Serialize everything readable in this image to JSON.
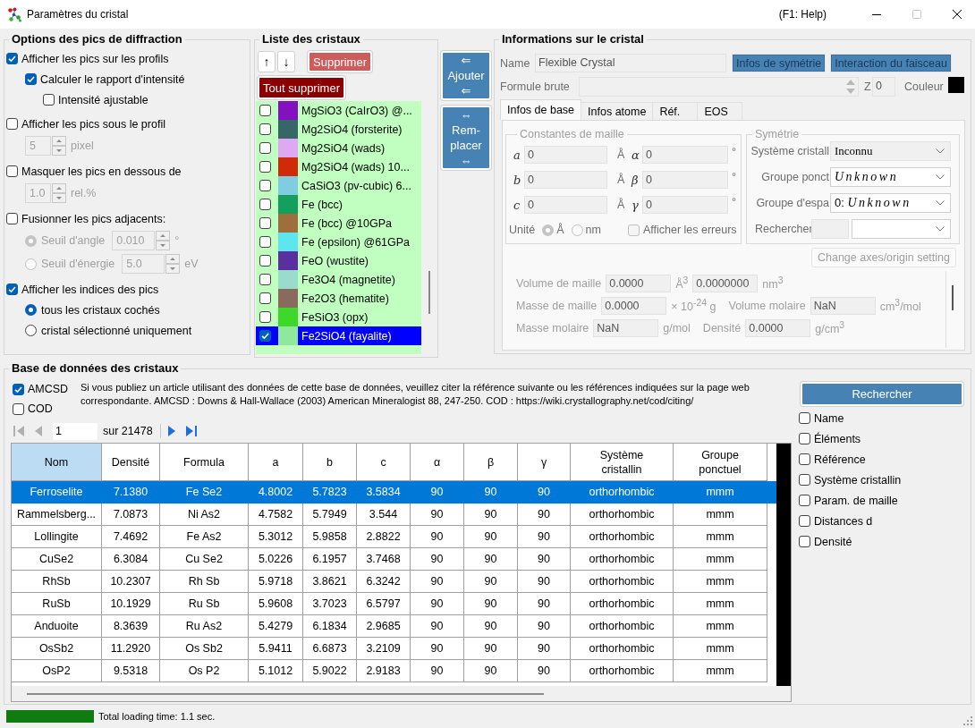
{
  "window": {
    "title": "Paramètres du cristal",
    "help_hint": "(F1: Help)"
  },
  "diffraction_options": {
    "title": "Options des pics de diffraction",
    "items": [
      {
        "kind": "checkbox",
        "label": "Afficher les pics sur les profils",
        "checked": true,
        "children": [
          {
            "kind": "checkbox",
            "label": "Calculer le rapport d'intensité",
            "checked": true,
            "children": [
              {
                "kind": "checkbox",
                "label": "Intensité ajustable",
                "checked": false
              }
            ]
          }
        ]
      },
      {
        "kind": "checkbox",
        "label": "Afficher les pics sous le profil",
        "checked": false,
        "children": [
          {
            "kind": "spinner",
            "value": "5",
            "unit": "pixel",
            "disabled": true
          }
        ]
      },
      {
        "kind": "checkbox",
        "label": "Masquer les pics en dessous de",
        "checked": false,
        "children": [
          {
            "kind": "spinner",
            "value": "1.0",
            "unit": "rel.%",
            "disabled": true
          }
        ]
      },
      {
        "kind": "checkbox",
        "label": "Fusionner les pics adjacents:",
        "checked": false,
        "children": [
          {
            "kind": "radio",
            "label": "Seuil d'angle",
            "selected": true,
            "disabled": true,
            "value": "0.010",
            "unit": "°"
          },
          {
            "kind": "radio",
            "label": "Seuil d'énergie",
            "selected": false,
            "disabled": true,
            "value": "5.0",
            "unit": "eV"
          }
        ]
      },
      {
        "kind": "checkbox",
        "label": "Afficher les indices des pics",
        "checked": true,
        "children": [
          {
            "kind": "radio",
            "label": "tous les cristaux cochés",
            "selected": true,
            "disabled": false
          },
          {
            "kind": "radio",
            "label": "cristal sélectionné uniquement",
            "selected": false,
            "disabled": false
          }
        ]
      }
    ]
  },
  "crystal_list": {
    "title": "Liste des cristaux",
    "buttons": [
      {
        "kind": "move",
        "label": "↑"
      },
      {
        "kind": "move",
        "label": "↓"
      },
      {
        "kind": "delete",
        "label": "Supprimer"
      },
      {
        "kind": "delete_all",
        "label": "Tout supprimer"
      }
    ],
    "items": [
      {
        "name": "MgSiO3 (CaIrO3) @...",
        "color": "#8411c0",
        "checked": false,
        "selected": false
      },
      {
        "name": "Mg2SiO4 (forsterite)",
        "color": "#376668",
        "checked": false,
        "selected": false
      },
      {
        "name": "Mg2SiO4 (wads)",
        "color": "#dfa8f2",
        "checked": false,
        "selected": false
      },
      {
        "name": "Mg2SiO4 (wads) 10...",
        "color": "#cf2a0a",
        "checked": false,
        "selected": false
      },
      {
        "name": "CaSiO3 (pv-cubic) 6...",
        "color": "#80cce0",
        "checked": false,
        "selected": false
      },
      {
        "name": "Fe (bcc)",
        "color": "#14a05c",
        "checked": false,
        "selected": false
      },
      {
        "name": "Fe (bcc) @10GPa",
        "color": "#9e6e3c",
        "checked": false,
        "selected": false
      },
      {
        "name": "Fe (epsilon) @61GPa",
        "color": "#5ee6ee",
        "checked": false,
        "selected": false
      },
      {
        "name": "FeO (wustite)",
        "color": "#5a2fa0",
        "checked": false,
        "selected": false
      },
      {
        "name": "Fe3O4 (magnetite)",
        "color": "#98dccc",
        "checked": false,
        "selected": false
      },
      {
        "name": "Fe2O3 (hematite)",
        "color": "#8a6a5a",
        "checked": false,
        "selected": false
      },
      {
        "name": "FeSiO3 (opx)",
        "color": "#3dd82a",
        "checked": false,
        "selected": false
      },
      {
        "name": "Fe2SiO4 (fayalite)",
        "color": "#90e89c",
        "checked": true,
        "selected": true
      }
    ]
  },
  "transfer_buttons": [
    {
      "label": "⇐\nAjouter\n⇐"
    },
    {
      "label": "⇔\nRem-\nplacer\n⇔"
    }
  ],
  "crystal_info": {
    "title": "Informations sur le cristal",
    "disabled": true,
    "name": {
      "label": "Name",
      "value": "Flexible Crystal"
    },
    "buttons": [
      {
        "label": "Infos de symétrie"
      },
      {
        "label": "Interaction du faisceau"
      }
    ],
    "formula": {
      "label": "Formule brute"
    },
    "z": {
      "label": "Z",
      "value": "0"
    },
    "color": {
      "label": "Couleur",
      "color": "#000000"
    },
    "tabs": [
      {
        "label": "Infos de base",
        "selected": true
      },
      {
        "label": "Infos atome",
        "selected": false
      },
      {
        "label": "Réf.",
        "selected": false
      },
      {
        "label": "EOS",
        "selected": false
      }
    ],
    "lattice": {
      "title": "Constantes de maille",
      "rows": [
        {
          "axis": "a",
          "value": "0",
          "unit": "Å",
          "angle": "α",
          "angle_value": "0",
          "angle_unit": "°"
        },
        {
          "axis": "b",
          "value": "0",
          "unit": "Å",
          "angle": "β",
          "angle_value": "0",
          "angle_unit": "°"
        },
        {
          "axis": "c",
          "value": "0",
          "unit": "Å",
          "angle": "γ",
          "angle_value": "0",
          "angle_unit": "°"
        }
      ],
      "unit_label": "Unité",
      "units": [
        {
          "label": "Å",
          "selected": true
        },
        {
          "label": "nm",
          "selected": false
        }
      ],
      "show_errors": {
        "label": "Afficher les erreurs",
        "checked": false
      }
    },
    "symmetry": {
      "title": "Symétrie",
      "fields": [
        {
          "kind": "serif",
          "label": "Système cristall",
          "value": "Inconnu"
        },
        {
          "kind": "symbol",
          "label": "Groupe ponct",
          "value": "Unknown"
        },
        {
          "kind": "mixed",
          "label": "Groupe d'espa",
          "value": "0: *Unknown*"
        },
        {
          "kind": "search",
          "label": "Rechercher"
        }
      ]
    },
    "change_axes_button": "Change axes/origin setting",
    "properties": [
      {
        "cells": [
          {
            "kind": "label",
            "text": "Volume de maille"
          },
          {
            "kind": "field",
            "text": "0.0000"
          },
          {
            "kind": "unit",
            "text": "Å$^{3}$"
          },
          {
            "kind": "field",
            "text": "0.0000000"
          },
          {
            "kind": "unit",
            "text": "nm$^{3}$"
          }
        ]
      },
      {
        "cells": [
          {
            "kind": "label",
            "text": "Masse de maille"
          },
          {
            "kind": "field",
            "text": "0.0000"
          },
          {
            "kind": "unit",
            "text": "× 10$^{-24}$ g"
          },
          {
            "kind": "label",
            "text": "Volume molaire"
          },
          {
            "kind": "field",
            "text": "NaN"
          },
          {
            "kind": "unit",
            "text": "cm$^{3}$/mol"
          }
        ]
      },
      {
        "cells": [
          {
            "kind": "label",
            "text": "Masse molaire"
          },
          {
            "kind": "field",
            "text": "NaN"
          },
          {
            "kind": "unit",
            "text": "g/mol"
          },
          {
            "kind": "label",
            "text": "Densité"
          },
          {
            "kind": "field",
            "text": "0.0000"
          },
          {
            "kind": "unit",
            "text": "g/cm$^{3}$"
          }
        ]
      }
    ]
  },
  "database": {
    "title": "Base de données des cristaux",
    "sources": [
      {
        "label": "AMCSD",
        "checked": true
      },
      {
        "label": "COD",
        "checked": false
      }
    ],
    "citation": "Si vous publiez un article utilisant des données de cette base de données, veuillez citer la référence suivante ou les références indiquées sur la page web correspondante. AMCSD : Downs & Hall-Wallace (2003) American Mineralogist 88, 247-250. COD : https://wiki.crystallography.net/cod/citing/",
    "pager": {
      "nav_buttons": [
        {
          "kind": "first",
          "disabled": true
        },
        {
          "kind": "previous",
          "disabled": true
        },
        {
          "kind": "next",
          "disabled": false
        },
        {
          "kind": "last",
          "disabled": false
        }
      ],
      "page": "1",
      "total": "sur 21478"
    },
    "search_button": "Rechercher",
    "filters": [
      {
        "label": "Name",
        "checked": false
      },
      {
        "label": "Éléments",
        "checked": false
      },
      {
        "label": "Référence",
        "checked": false
      },
      {
        "label": "Système cristallin",
        "checked": false
      },
      {
        "label": "Param. de maille",
        "checked": false
      },
      {
        "label": "Distances d",
        "checked": false
      },
      {
        "label": "Densité",
        "checked": false
      }
    ],
    "table": {
      "columns": [
        {
          "label": "Nom",
          "selected": true
        },
        {
          "label": "Densité",
          "selected": false
        },
        {
          "label": "Formula",
          "selected": false
        },
        {
          "label": "a",
          "selected": false
        },
        {
          "label": "b",
          "selected": false
        },
        {
          "label": "c",
          "selected": false
        },
        {
          "label": "α",
          "selected": false
        },
        {
          "label": "β",
          "selected": false
        },
        {
          "label": "γ",
          "selected": false
        },
        {
          "label": "Système\ncristallin",
          "selected": false
        },
        {
          "label": "Groupe\nponctuel",
          "selected": false
        }
      ],
      "rows": [
        {
          "selected": true,
          "cells": [
            "Ferroselite",
            "7.1380",
            "Fe Se2",
            "4.8002",
            "5.7823",
            "3.5834",
            "90",
            "90",
            "90",
            "orthorhombic",
            "mmm"
          ]
        },
        {
          "selected": false,
          "cells": [
            "Rammelsberg...",
            "7.0873",
            "Ni As2",
            "4.7582",
            "5.7949",
            "3.544",
            "90",
            "90",
            "90",
            "orthorhombic",
            "mmm"
          ]
        },
        {
          "selected": false,
          "cells": [
            "Lollingite",
            "7.4692",
            "Fe As2",
            "5.3012",
            "5.9858",
            "2.8822",
            "90",
            "90",
            "90",
            "orthorhombic",
            "mmm"
          ]
        },
        {
          "selected": false,
          "cells": [
            "CuSe2",
            "6.3084",
            "Cu Se2",
            "5.0226",
            "6.1957",
            "3.7468",
            "90",
            "90",
            "90",
            "orthorhombic",
            "mmm"
          ]
        },
        {
          "selected": false,
          "cells": [
            "RhSb",
            "10.2307",
            "Rh Sb",
            "5.9718",
            "3.8621",
            "6.3242",
            "90",
            "90",
            "90",
            "orthorhombic",
            "mmm"
          ]
        },
        {
          "selected": false,
          "cells": [
            "RuSb",
            "10.1929",
            "Ru Sb",
            "5.9608",
            "3.7023",
            "6.5797",
            "90",
            "90",
            "90",
            "orthorhombic",
            "mmm"
          ]
        },
        {
          "selected": false,
          "cells": [
            "Anduoite",
            "8.3639",
            "Ru As2",
            "5.4279",
            "6.1834",
            "2.9685",
            "90",
            "90",
            "90",
            "orthorhombic",
            "mmm"
          ]
        },
        {
          "selected": false,
          "cells": [
            "OsSb2",
            "11.2920",
            "Os Sb2",
            "5.9411",
            "6.6873",
            "3.2109",
            "90",
            "90",
            "90",
            "orthorhombic",
            "mmm"
          ]
        },
        {
          "selected": false,
          "cells": [
            "OsP2",
            "9.5318",
            "Os P2",
            "5.1012",
            "5.9022",
            "2.9183",
            "90",
            "90",
            "90",
            "orthorhombic",
            "mmm"
          ]
        }
      ]
    }
  },
  "status_bar": {
    "level": 1,
    "text": "Total loading time: 1.1 sec."
  }
}
